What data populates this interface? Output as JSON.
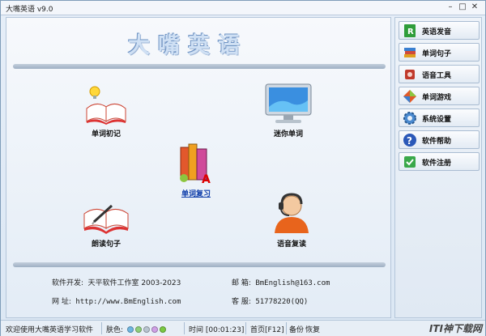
{
  "window": {
    "title": "大嘴英语 v9.0"
  },
  "app_title": "大嘴英语",
  "features": {
    "word_first": "单词初记",
    "mini_word": "迷你单词",
    "word_review": "单词复习",
    "read_sentence": "朗读句子",
    "voice_repeat": "语音复读"
  },
  "info": {
    "developer_label": "软件开发:",
    "developer_value": "天平软件工作室 2003-2023",
    "email_label": "邮    箱:",
    "email_value": "BmEnglish@163.com",
    "site_label": "网    址:",
    "site_value": "http://www.BmEnglish.com",
    "service_label": "客    服:",
    "service_value": "51778220(QQ)"
  },
  "sidebar": {
    "items": [
      {
        "label": "英语发音",
        "icon": "r-book-icon"
      },
      {
        "label": "单词句子",
        "icon": "book-stack-icon"
      },
      {
        "label": "语音工具",
        "icon": "speaker-icon"
      },
      {
        "label": "单词游戏",
        "icon": "puzzle-icon"
      },
      {
        "label": "系统设置",
        "icon": "gear-icon"
      },
      {
        "label": "软件帮助",
        "icon": "help-icon"
      },
      {
        "label": "软件注册",
        "icon": "register-icon"
      }
    ]
  },
  "status": {
    "welcome": "欢迎使用大嘴英语学习软件",
    "skin_label": "肤色:",
    "skin_colors": [
      "#6fb6e0",
      "#8fce7a",
      "#b8c4d0",
      "#cfa0e6",
      "#7ac943"
    ],
    "time_label": "时间",
    "time_value": "[00:01:23]",
    "home": "首页[F12]",
    "backup": "备份",
    "restore": "恢复"
  },
  "watermark": "ITI神下载网"
}
